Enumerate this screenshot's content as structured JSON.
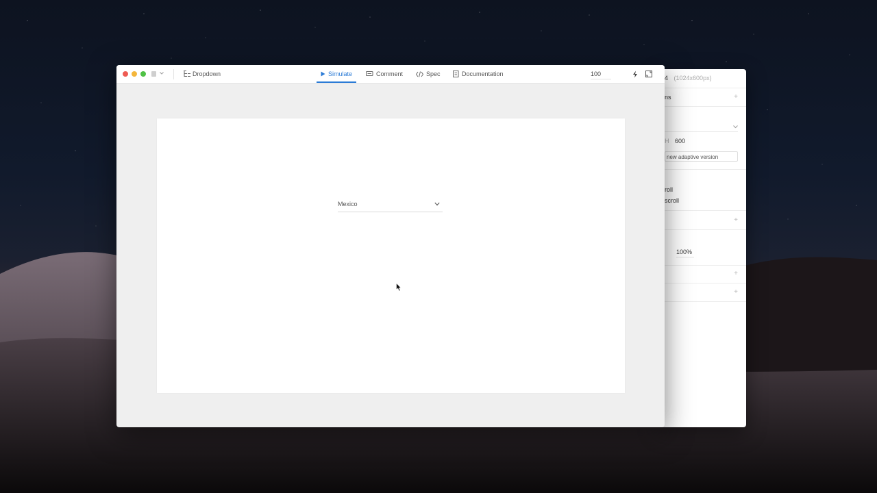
{
  "background_window": {
    "title_fragment": "4",
    "size_label": "(1024x600px)",
    "row1_label": "ns",
    "height_label": "H",
    "height_value": "600",
    "adaptive_button": "new adaptive version",
    "scroll_option_1": "roll",
    "scroll_option_2": "scroll",
    "percent_value": "100%"
  },
  "main_window": {
    "document_title": "Dropdown",
    "tabs": [
      {
        "label": "Simulate",
        "icon": "play-icon",
        "active": true
      },
      {
        "label": "Comment",
        "icon": "comment-icon",
        "active": false
      },
      {
        "label": "Spec",
        "icon": "code-icon",
        "active": false
      },
      {
        "label": "Documentation",
        "icon": "document-icon",
        "active": false
      }
    ],
    "zoom": "100",
    "accent_color": "#2b7bd6"
  },
  "canvas": {
    "dropdown": {
      "selected_value": "Mexico"
    }
  }
}
